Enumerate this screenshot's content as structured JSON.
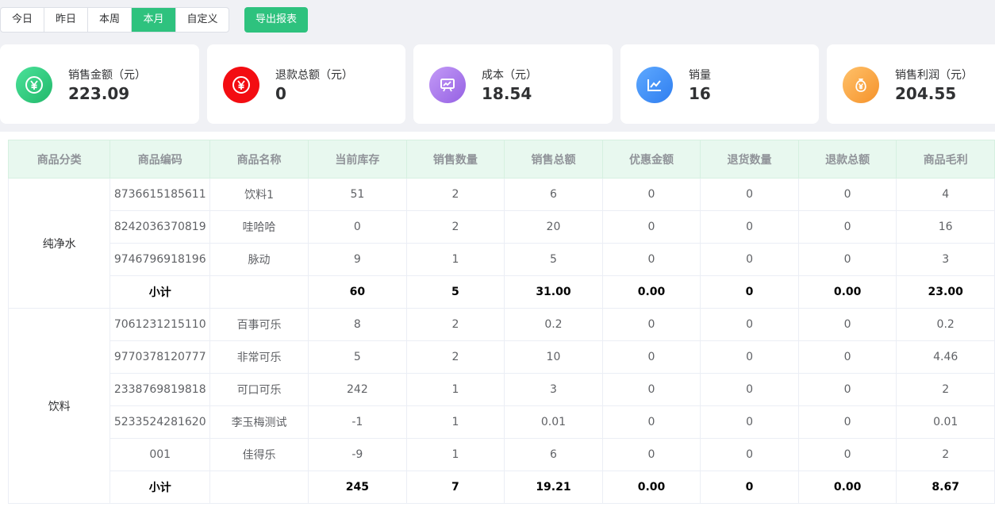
{
  "toolbar": {
    "ranges": [
      "今日",
      "昨日",
      "本周",
      "本月",
      "自定义"
    ],
    "active_range": "本月",
    "export_label": "导出报表"
  },
  "cards": [
    {
      "label": "销售金额（元）",
      "value": "223.09",
      "icon": "yen-icon",
      "color": "#2ec27e"
    },
    {
      "label": "退款总额（元）",
      "value": "0",
      "icon": "yen-icon",
      "color": "#f5222d"
    },
    {
      "label": "成本（元）",
      "value": "18.54",
      "icon": "presentation-chart-icon",
      "color": "#a57ce8"
    },
    {
      "label": "销量",
      "value": "16",
      "icon": "line-chart-icon",
      "color": "#3d8ef0"
    },
    {
      "label": "销售利润（元）",
      "value": "204.55",
      "icon": "money-bag-icon",
      "color": "#f7a23d"
    }
  ],
  "table": {
    "headers": [
      "商品分类",
      "商品编码",
      "商品名称",
      "当前库存",
      "销售数量",
      "销售总额",
      "优惠金额",
      "退货数量",
      "退款总额",
      "商品毛利"
    ],
    "groups": [
      {
        "category": "纯净水",
        "rows": [
          [
            "8736615185611",
            "饮料1",
            "51",
            "2",
            "6",
            "0",
            "0",
            "0",
            "4"
          ],
          [
            "8242036370819",
            "哇哈哈",
            "0",
            "2",
            "20",
            "0",
            "0",
            "0",
            "16"
          ],
          [
            "9746796918196",
            "脉动",
            "9",
            "1",
            "5",
            "0",
            "0",
            "0",
            "3"
          ]
        ],
        "subtotal": [
          "小计",
          "",
          "60",
          "5",
          "31.00",
          "0.00",
          "0",
          "0.00",
          "23.00"
        ]
      },
      {
        "category": "饮料",
        "rows": [
          [
            "7061231215110",
            "百事可乐",
            "8",
            "2",
            "0.2",
            "0",
            "0",
            "0",
            "0.2"
          ],
          [
            "9770378120777",
            "非常可乐",
            "5",
            "2",
            "10",
            "0",
            "0",
            "0",
            "4.46"
          ],
          [
            "2338769819818",
            "可口可乐",
            "242",
            "1",
            "3",
            "0",
            "0",
            "0",
            "2"
          ],
          [
            "5233524281620",
            "李玉梅测试",
            "-1",
            "1",
            "0.01",
            "0",
            "0",
            "0",
            "0.01"
          ],
          [
            "001",
            "佳得乐",
            "-9",
            "1",
            "6",
            "0",
            "0",
            "0",
            "2"
          ]
        ],
        "subtotal": [
          "小计",
          "",
          "245",
          "7",
          "19.21",
          "0.00",
          "0",
          "0.00",
          "8.67"
        ]
      }
    ]
  }
}
